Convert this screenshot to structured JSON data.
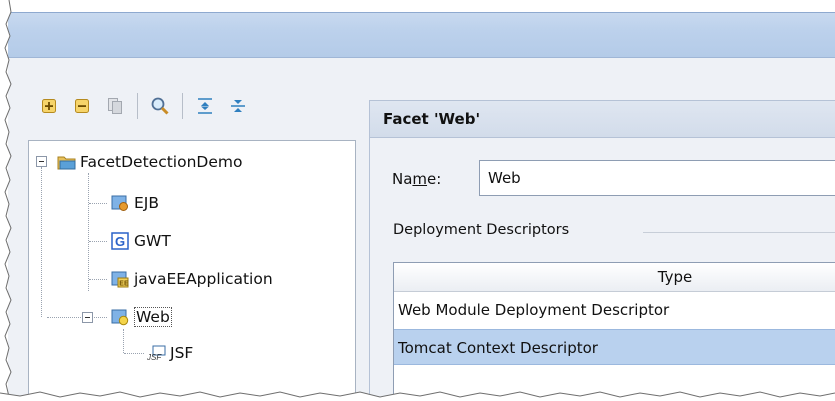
{
  "toolbar": {
    "buttons": [
      {
        "name": "expand-all-icon"
      },
      {
        "name": "collapse-all-icon"
      },
      {
        "name": "copy-icon"
      },
      {
        "name": "search-icon"
      },
      {
        "name": "expand-tree-icon"
      },
      {
        "name": "collapse-tree-icon"
      }
    ]
  },
  "tree": {
    "root": {
      "label": "FacetDetectionDemo",
      "icon": "project-folder-icon"
    },
    "items": [
      {
        "label": "EJB",
        "icon": "ejb-icon"
      },
      {
        "label": "GWT",
        "icon": "gwt-icon"
      },
      {
        "label": "javaEEApplication",
        "icon": "javaee-application-icon"
      },
      {
        "label": "Web",
        "icon": "web-module-icon"
      },
      {
        "label": "JSF",
        "icon": "jsf-icon"
      }
    ]
  },
  "facet": {
    "header": "Facet 'Web'",
    "name_label_pre": "Na",
    "name_label_mnemonic": "m",
    "name_label_post": "e:",
    "name_value": "Web",
    "descriptors_title": "Deployment Descriptors",
    "table": {
      "header": "Type",
      "rows": [
        "Web Module Deployment Descriptor",
        "Tomcat Context Descriptor"
      ],
      "selected_row": 1
    }
  },
  "colors": {
    "titlebar": "#bcd1ec",
    "selection": "#b9d1ee",
    "panel": "#eef1f6"
  }
}
